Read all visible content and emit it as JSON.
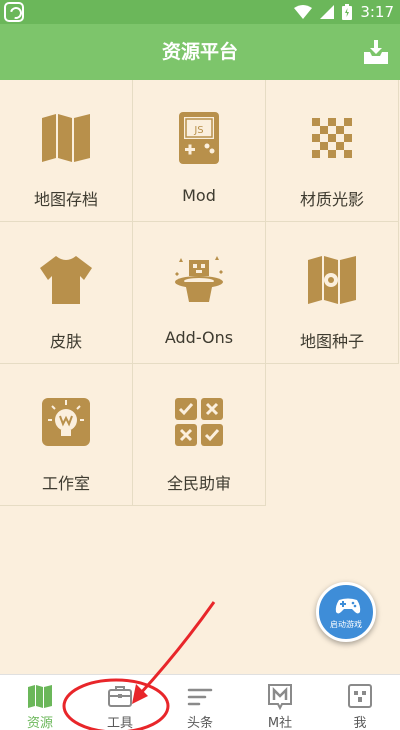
{
  "status_bar": {
    "time": "3:17"
  },
  "header": {
    "title": "资源平台",
    "download_icon": "download-tray-icon"
  },
  "grid": [
    {
      "label": "地图存档",
      "icon": "map-icon"
    },
    {
      "label": "Mod",
      "icon": "gameboy-js-icon"
    },
    {
      "label": "材质光影",
      "icon": "checker-texture-icon"
    },
    {
      "label": "皮肤",
      "icon": "shirt-icon"
    },
    {
      "label": "Add-Ons",
      "icon": "magic-hat-icon"
    },
    {
      "label": "地图种子",
      "icon": "map-seed-icon"
    },
    {
      "label": "工作室",
      "icon": "studio-bulb-icon"
    },
    {
      "label": "全民助审",
      "icon": "review-checklist-icon"
    }
  ],
  "fab": {
    "label": "启动游戏",
    "icon": "gamepad-icon"
  },
  "bottom_nav": [
    {
      "label": "资源",
      "icon": "map-icon",
      "active": true
    },
    {
      "label": "工具",
      "icon": "toolbox-icon",
      "active": false
    },
    {
      "label": "头条",
      "icon": "headlines-icon",
      "active": false
    },
    {
      "label": "M社",
      "icon": "m-community-icon",
      "active": false
    },
    {
      "label": "我",
      "icon": "profile-icon",
      "active": false
    }
  ],
  "colors": {
    "header": "#7DC56B",
    "status_bar": "#6BB75A",
    "background": "#FBEFDD",
    "icon": "#B8904B",
    "active_nav": "#6BB75A",
    "fab": "#3E8DD8",
    "annotation": "#E8262A"
  }
}
